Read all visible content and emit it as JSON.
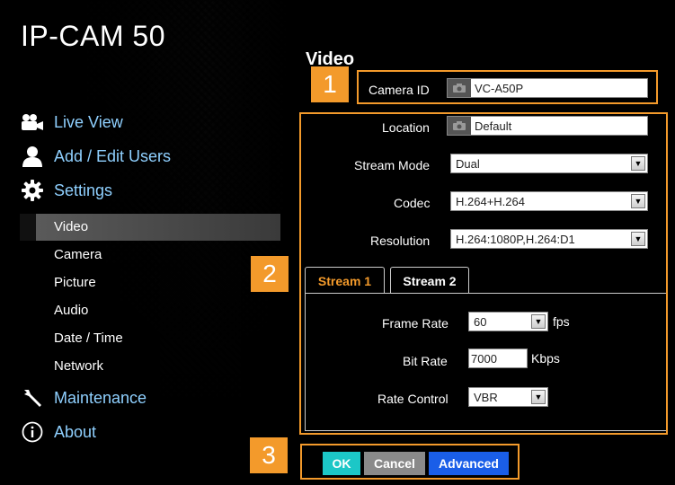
{
  "brand": "IP-CAM 50",
  "nav": {
    "live_view": "Live View",
    "add_edit_users": "Add / Edit Users",
    "settings": "Settings",
    "maintenance": "Maintenance",
    "about": "About"
  },
  "settings_items": [
    "Video",
    "Camera",
    "Picture",
    "Audio",
    "Date / Time",
    "Network"
  ],
  "active_item": "Video",
  "page_title": "Video",
  "badges": [
    "1",
    "2",
    "3"
  ],
  "form": {
    "camera_id": {
      "label": "Camera ID",
      "value": "VC-A50P"
    },
    "location": {
      "label": "Location",
      "value": "Default"
    },
    "stream_mode": {
      "label": "Stream Mode",
      "value": "Dual"
    },
    "codec": {
      "label": "Codec",
      "value": "H.264+H.264"
    },
    "resolution": {
      "label": "Resolution",
      "value": "H.264:1080P,H.264:D1"
    }
  },
  "tabs": {
    "stream1": "Stream 1",
    "stream2": "Stream 2",
    "active": "Stream 1"
  },
  "stream": {
    "frame_rate": {
      "label": "Frame Rate",
      "value": "60",
      "unit": "fps"
    },
    "bit_rate": {
      "label": "Bit Rate",
      "value": "7000",
      "unit": "Kbps"
    },
    "rate_control": {
      "label": "Rate Control",
      "value": "VBR"
    }
  },
  "buttons": {
    "ok": "OK",
    "cancel": "Cancel",
    "advanced": "Advanced"
  },
  "colors": {
    "accent": "#f39a2b",
    "nav_link": "#8fd0ff",
    "ok": "#1cc7c7",
    "cancel": "#8a8a8a",
    "advanced": "#1a5ee8"
  },
  "icons": {
    "live_view": "video-camera-icon",
    "add_edit_users": "user-icon",
    "settings": "gear-icon",
    "maintenance": "wrench-icon",
    "about": "info-icon",
    "field": "camera-icon",
    "dropdown": "chevron-down-icon"
  }
}
